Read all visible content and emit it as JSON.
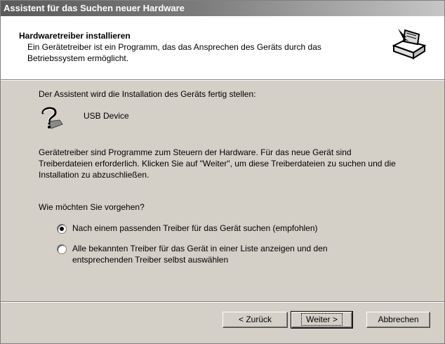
{
  "window": {
    "title": "Assistent für das Suchen neuer Hardware"
  },
  "header": {
    "title": "Hardwaretreiber installieren",
    "description": "Ein Gerätetreiber ist ein Programm, das das Ansprechen des Geräts durch das Betriebssystem ermöglicht.",
    "icon": "hardware-install-icon"
  },
  "main": {
    "intro": "Der Assistent wird die Installation des Geräts fertig stellen:",
    "device": {
      "icon": "unknown-device-icon",
      "name": "USB Device"
    },
    "info": "Gerätetreiber sind Programme zum Steuern der Hardware. Für das neue Gerät sind Treiberdateien erforderlich. Klicken Sie auf \"Weiter\", um diese Treiberdateien zu suchen und die Installation zu abzuschließen.",
    "question": "Wie möchten Sie vorgehen?",
    "options": [
      {
        "label": "Nach einem passenden Treiber für das Gerät suchen (empfohlen)",
        "checked": true
      },
      {
        "label": "Alle bekannten Treiber für das Gerät in einer Liste anzeigen und den entsprechenden Treiber selbst auswählen",
        "checked": false
      }
    ]
  },
  "buttons": {
    "back": "< Zurück",
    "next": "Weiter >",
    "cancel": "Abbrechen"
  },
  "colors": {
    "dialog": "#d4d0c8",
    "titlebar_dark": "#5a5a5a",
    "titlebar_light": "#c6c6c6"
  }
}
